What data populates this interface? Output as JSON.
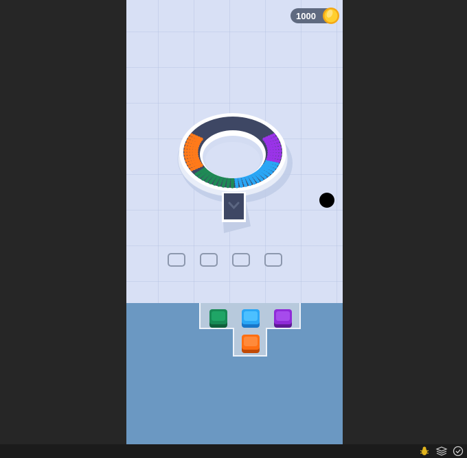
{
  "hud": {
    "coins": "1000",
    "coin_icon": "gold-coin-icon"
  },
  "ring": {
    "dock": "conveyor-exit",
    "segments": [
      {
        "color_name": "orange",
        "color": "#ff7a1a"
      },
      {
        "color_name": "green",
        "color": "#1f8a55"
      },
      {
        "color_name": "blue",
        "color": "#2aa6f5"
      },
      {
        "color_name": "purple",
        "color": "#9a33e8"
      }
    ]
  },
  "slots": [
    {
      "state": "empty"
    },
    {
      "state": "empty"
    },
    {
      "state": "empty"
    },
    {
      "state": "empty"
    }
  ],
  "blocks": [
    {
      "color_name": "green",
      "color": "#178a55"
    },
    {
      "color_name": "blue",
      "color": "#2aa6f5"
    },
    {
      "color_name": "purple",
      "color": "#8f2bd8"
    },
    {
      "color_name": "orange",
      "color": "#ff6f12"
    }
  ],
  "taskbar": {
    "icons": [
      "bug-icon",
      "layers-icon",
      "check-circle-icon"
    ]
  }
}
